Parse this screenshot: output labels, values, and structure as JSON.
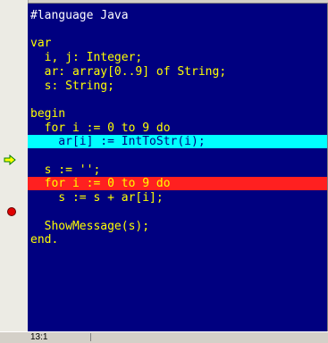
{
  "editor": {
    "lines": [
      "#language Java",
      "",
      "var",
      "  i, j: Integer;",
      "  ar: array[0..9] of String;",
      "  s: String;",
      "",
      "begin",
      "  for i := 0 to 9 do",
      "    ar[i] := IntToStr(i);",
      "",
      "  s := '';",
      "  for i := 0 to 9 do",
      "    s := s + ar[i];",
      "",
      "  ShowMessage(s);",
      "end."
    ],
    "execution_line_index": 9,
    "breakpoint_line_index": 12,
    "colors": {
      "background": "#000080",
      "text": "#ffff00",
      "comment": "#ffffff",
      "execution_highlight": "#00ffff",
      "breakpoint_highlight": "#ff2020"
    }
  },
  "gutter": {
    "execution_marker_icon": "execution-arrow-icon",
    "breakpoint_marker_icon": "breakpoint-dot-icon"
  },
  "status_bar": {
    "cursor_position": "13:1"
  }
}
